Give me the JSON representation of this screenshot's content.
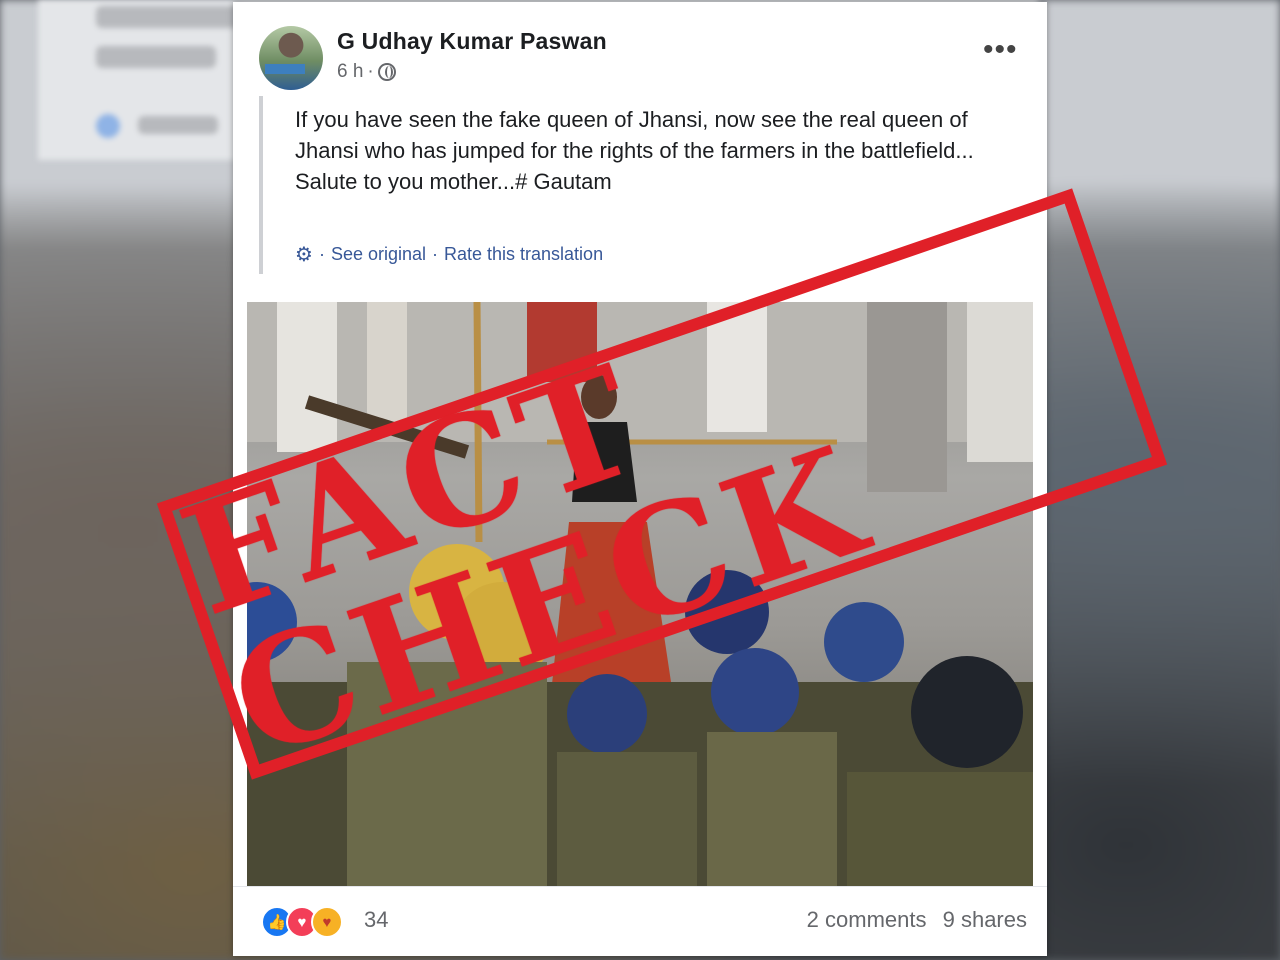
{
  "post": {
    "author": "G Udhay Kumar Paswan",
    "time": "6 h",
    "time_separator": "·",
    "more_label": "•••",
    "text_lines": [
      "If you have seen the fake queen of Jhansi, now see the real queen of Jhansi who has jumped for the rights of the farmers in the battlefield...",
      "Salute to you mother...# Gautam"
    ],
    "see_original": "See original",
    "rate_translation": "Rate this translation",
    "reaction_count": "34",
    "comments": "2 comments",
    "shares": "9 shares"
  },
  "stamp": {
    "text": "FACT CHECK",
    "color": "#e02028"
  },
  "icons": [
    "globe-icon",
    "gear-icon",
    "more-icon",
    "like-reaction-icon",
    "love-reaction-icon",
    "care-reaction-icon"
  ]
}
